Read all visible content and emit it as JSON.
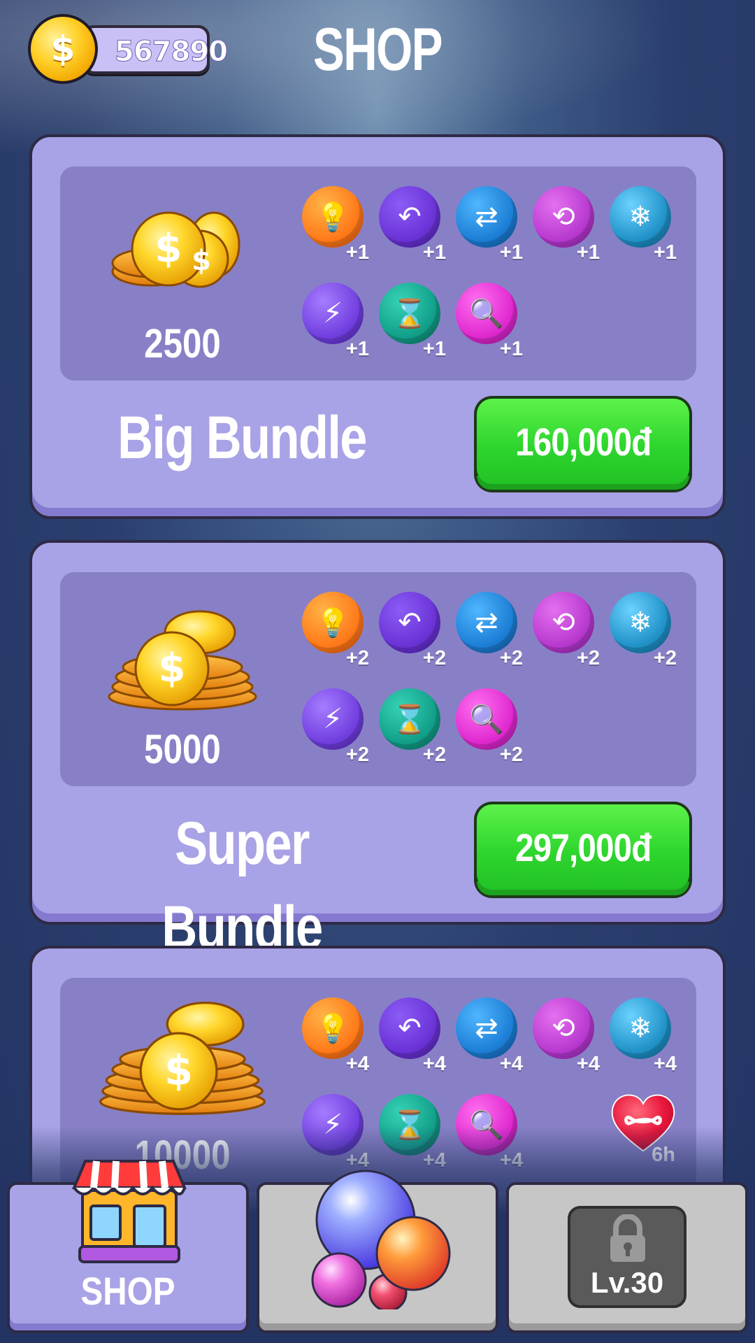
{
  "header": {
    "coin_balance": "567890",
    "coin_symbol": "$",
    "title": "SHOP"
  },
  "bundles": [
    {
      "coins": "2500",
      "name": "Big Bundle",
      "price": "160,000đ",
      "items": [
        {
          "icon": "lightbulb-icon",
          "count": "+1"
        },
        {
          "icon": "undo-arrow-icon",
          "count": "+1"
        },
        {
          "icon": "shuffle-arrows-icon",
          "count": "+1"
        },
        {
          "icon": "swap-arrows-icon",
          "count": "+1"
        },
        {
          "icon": "freeze-hourglass-icon",
          "count": "+1"
        },
        {
          "icon": "lightning-icon",
          "count": "+1"
        },
        {
          "icon": "add-time-hourglass-icon",
          "count": "+1"
        },
        {
          "icon": "magnifier-icon",
          "count": "+1"
        }
      ]
    },
    {
      "coins": "5000",
      "name": "Super Bundle",
      "price": "297,000đ",
      "items": [
        {
          "icon": "lightbulb-icon",
          "count": "+2"
        },
        {
          "icon": "undo-arrow-icon",
          "count": "+2"
        },
        {
          "icon": "shuffle-arrows-icon",
          "count": "+2"
        },
        {
          "icon": "swap-arrows-icon",
          "count": "+2"
        },
        {
          "icon": "freeze-hourglass-icon",
          "count": "+2"
        },
        {
          "icon": "lightning-icon",
          "count": "+2"
        },
        {
          "icon": "add-time-hourglass-icon",
          "count": "+2"
        },
        {
          "icon": "magnifier-icon",
          "count": "+2"
        }
      ]
    },
    {
      "coins": "10000",
      "items": [
        {
          "icon": "lightbulb-icon",
          "count": "+4"
        },
        {
          "icon": "undo-arrow-icon",
          "count": "+4"
        },
        {
          "icon": "shuffle-arrows-icon",
          "count": "+4"
        },
        {
          "icon": "swap-arrows-icon",
          "count": "+4"
        },
        {
          "icon": "freeze-hourglass-icon",
          "count": "+4"
        },
        {
          "icon": "lightning-icon",
          "count": "+4"
        },
        {
          "icon": "add-time-hourglass-icon",
          "count": "+4"
        },
        {
          "icon": "magnifier-icon",
          "count": "+4"
        }
      ],
      "bonus": {
        "icon": "infinite-heart-icon",
        "duration": "6h"
      }
    }
  ],
  "nav": {
    "shop_label": "SHOP",
    "lock_label": "Lv.30",
    "tabs": [
      "shop",
      "balls",
      "locked"
    ]
  },
  "colors": {
    "card": "#a8a2e6",
    "panel": "#8880c6",
    "buy_button": "#2fd62e",
    "text": "#ffffff"
  }
}
